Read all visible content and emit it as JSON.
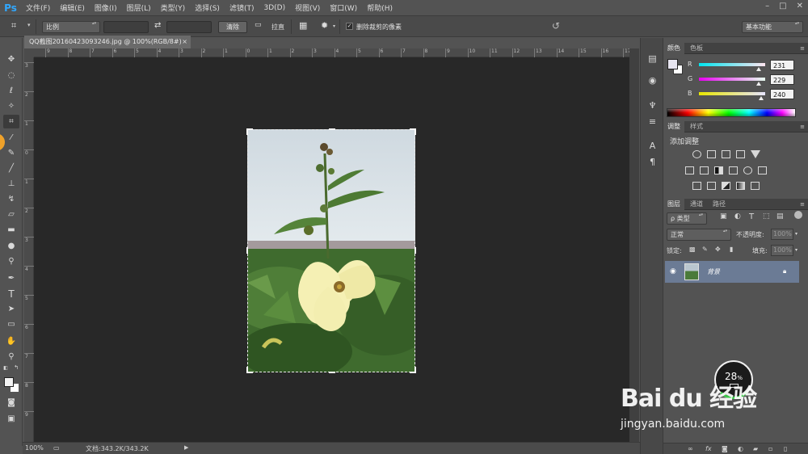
{
  "app": {
    "logo": "Ps",
    "menu": [
      "文件(F)",
      "编辑(E)",
      "图像(I)",
      "图层(L)",
      "类型(Y)",
      "选择(S)",
      "滤镜(T)",
      "3D(D)",
      "视图(V)",
      "窗口(W)",
      "帮助(H)"
    ],
    "window_controls": [
      "–",
      "□",
      "✕"
    ]
  },
  "options": {
    "ratio_select": "比例",
    "clear_button": "清除",
    "straighten_label": "拉直",
    "delete_cropped_label": "删除裁剪的像素",
    "delete_cropped_checked": true,
    "workspace_select": "基本功能"
  },
  "document": {
    "tab_title": "QQ截图20160423093246.jpg @ 100%(RGB/8#)",
    "close": "×",
    "ruler_h_labels": [
      "9",
      "8",
      "7",
      "6",
      "5",
      "4",
      "3",
      "2",
      "1",
      "0",
      "1",
      "2",
      "3",
      "4",
      "5",
      "6",
      "7",
      "8",
      "9",
      "10",
      "11",
      "12",
      "13",
      "14",
      "15",
      "16",
      "17"
    ],
    "ruler_v_labels": [
      "3",
      "2",
      "1",
      "0",
      "1",
      "2",
      "3",
      "4",
      "5",
      "6",
      "7",
      "8",
      "9"
    ]
  },
  "status": {
    "zoom": "100%",
    "doc_info": "文档:343.2K/343.2K"
  },
  "color_panel": {
    "tabs": [
      "颜色",
      "色板"
    ],
    "r_label": "R",
    "r_value": "231",
    "g_label": "G",
    "g_value": "229",
    "b_label": "B",
    "b_value": "240",
    "r_fraction": 0.906,
    "g_fraction": 0.898,
    "b_fraction": 0.941
  },
  "adjustments_panel": {
    "tabs": [
      "调整",
      "样式"
    ],
    "title": "添加调整"
  },
  "layers_panel": {
    "tabs": [
      "图层",
      "通道",
      "路径"
    ],
    "filter_label": "ρ 类型",
    "blend_mode": "正常",
    "opacity_label": "不透明度:",
    "opacity_value": "100%",
    "lock_label": "锁定:",
    "fill_label": "填充:",
    "fill_value": "100%",
    "layer_name": "背景"
  },
  "overlay": {
    "perf_value": "28",
    "perf_unit": "%",
    "watermark": "Bai du 经验",
    "watermark_url": "jingyan.baidu.com"
  }
}
